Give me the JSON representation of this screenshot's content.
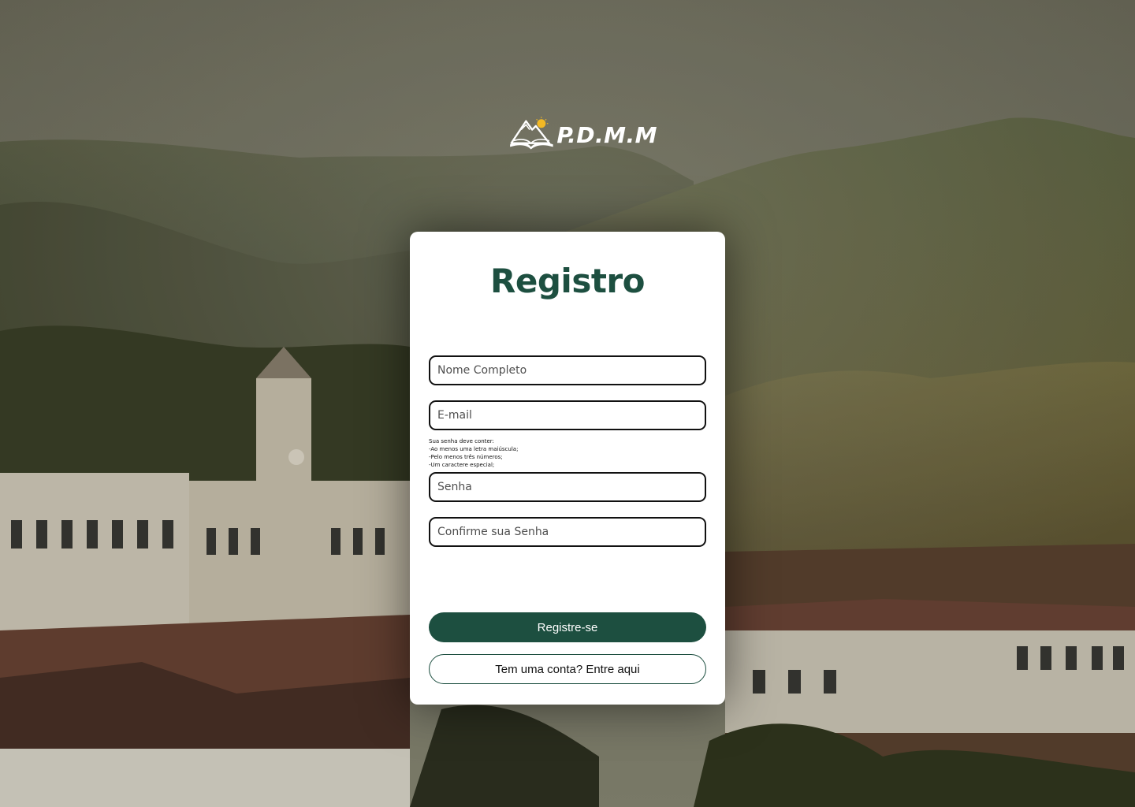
{
  "brand": {
    "name": "P.D.M.M",
    "logo_icon": "mountain-book-sun-icon"
  },
  "form": {
    "title": "Registro",
    "fields": {
      "full_name": {
        "placeholder": "Nome Completo",
        "value": ""
      },
      "email": {
        "placeholder": "E-mail",
        "value": ""
      },
      "password": {
        "placeholder": "Senha",
        "value": ""
      },
      "confirm_password": {
        "placeholder": "Confirme sua Senha",
        "value": ""
      }
    },
    "password_hint": {
      "line1": "Sua senha deve conter:",
      "line2": "-Ao menos uma letra maiúscula;",
      "line3": "-Pelo menos três números;",
      "line4": "-Um caractere especial;"
    },
    "submit_label": "Registre-se",
    "login_label": "Tem uma conta? Entre aqui"
  },
  "colors": {
    "primary": "#1d4f40",
    "card": "#ffffff",
    "sun": "#f2b824"
  }
}
